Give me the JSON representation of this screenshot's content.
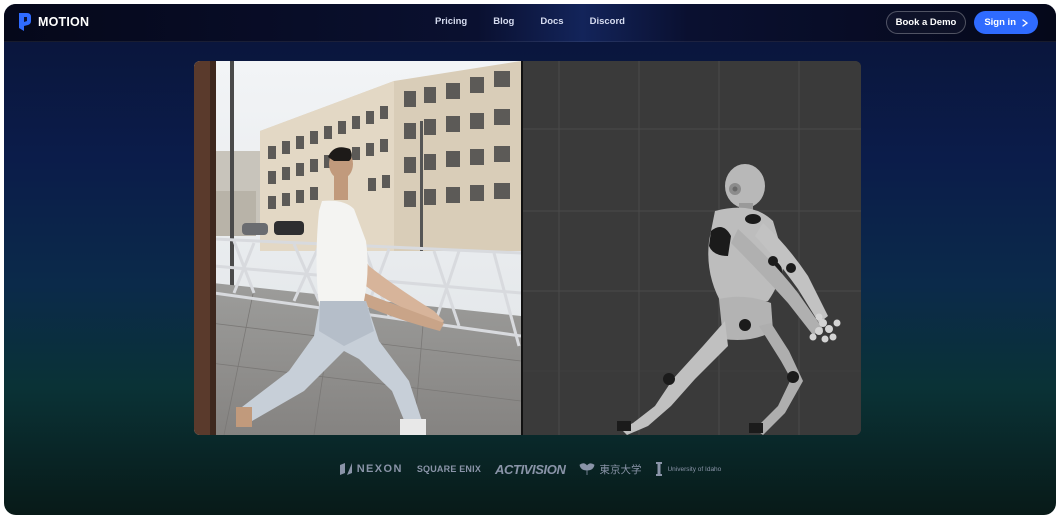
{
  "brand": {
    "name": "MOTION"
  },
  "nav": {
    "links": [
      "Pricing",
      "Blog",
      "Docs",
      "Discord"
    ],
    "book_demo": "Book a Demo",
    "sign_in": "Sign in"
  },
  "logos": {
    "nexon": "NEXON",
    "square_enix": "SQUARE ENIX",
    "activision": "ACTIVISION",
    "tokyo": "東京大学",
    "idaho": "University of Idaho"
  },
  "colors": {
    "accent": "#2f6bff",
    "background_top": "#0a1438",
    "background_bottom": "#081a18",
    "logo_gray": "#8a94a8"
  }
}
